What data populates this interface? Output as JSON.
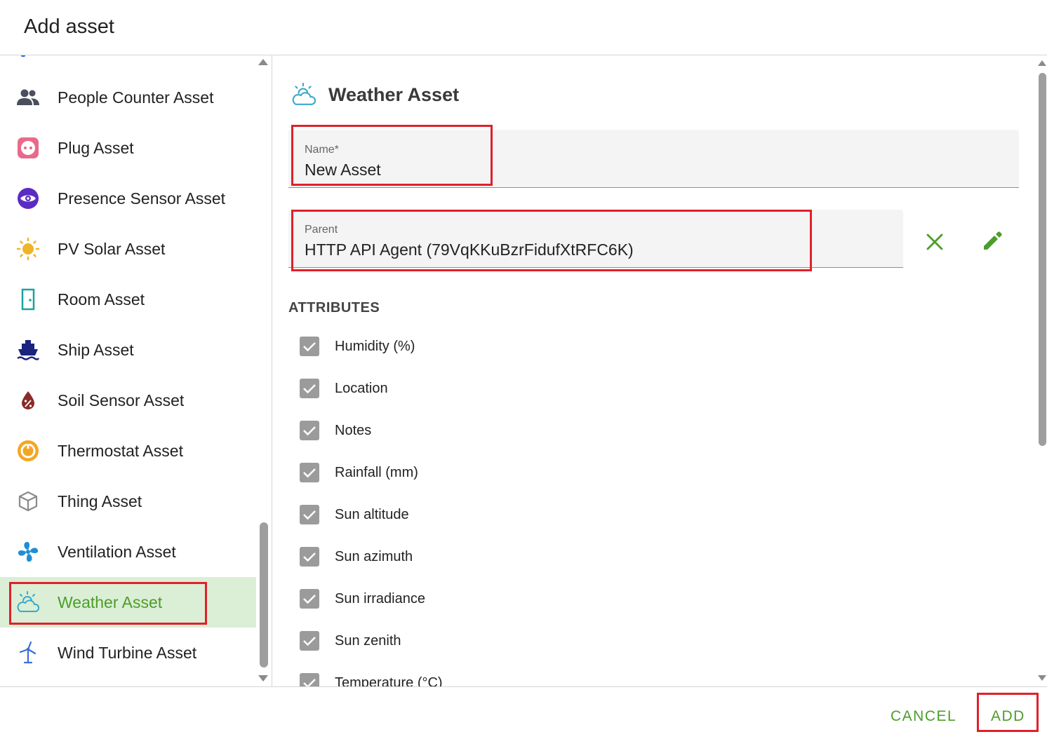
{
  "dialog": {
    "title": "Add asset"
  },
  "asset_list": {
    "items": [
      {
        "label": "People Counter Asset",
        "icon": "people-icon",
        "color": "#4a4f5c"
      },
      {
        "label": "Plug Asset",
        "icon": "plug-icon",
        "color": "#e86a8a"
      },
      {
        "label": "Presence Sensor Asset",
        "icon": "eye-icon",
        "color": "#5b2bc4"
      },
      {
        "label": "PV Solar Asset",
        "icon": "sun-icon",
        "color": "#f0b429"
      },
      {
        "label": "Room Asset",
        "icon": "door-icon",
        "color": "#1aa3a0"
      },
      {
        "label": "Ship Asset",
        "icon": "ship-icon",
        "color": "#1a237e"
      },
      {
        "label": "Soil Sensor Asset",
        "icon": "water-percent-icon",
        "color": "#8b2a2a"
      },
      {
        "label": "Thermostat Asset",
        "icon": "thermostat-icon",
        "color": "#f4a623"
      },
      {
        "label": "Thing Asset",
        "icon": "cube-icon",
        "color": "#8a8a8a"
      },
      {
        "label": "Ventilation Asset",
        "icon": "fan-icon",
        "color": "#1e8fd6"
      },
      {
        "label": "Weather Asset",
        "icon": "weather-icon",
        "color": "#3aa9c9",
        "selected": true
      },
      {
        "label": "Wind Turbine Asset",
        "icon": "wind-turbine-icon",
        "color": "#3a6fd6"
      }
    ]
  },
  "detail": {
    "title": "Weather Asset",
    "name_field": {
      "label": "Name*",
      "value": "New Asset"
    },
    "parent_field": {
      "label": "Parent",
      "value": "HTTP API Agent (79VqKKuBzrFidufXtRFC6K)"
    },
    "attributes_heading": "ATTRIBUTES",
    "attributes": [
      {
        "label": "Humidity (%)",
        "checked": true
      },
      {
        "label": "Location",
        "checked": true
      },
      {
        "label": "Notes",
        "checked": true
      },
      {
        "label": "Rainfall (mm)",
        "checked": true
      },
      {
        "label": "Sun altitude",
        "checked": true
      },
      {
        "label": "Sun azimuth",
        "checked": true
      },
      {
        "label": "Sun irradiance",
        "checked": true
      },
      {
        "label": "Sun zenith",
        "checked": true
      },
      {
        "label": "Temperature (°C)",
        "checked": true
      }
    ]
  },
  "footer": {
    "cancel_label": "CANCEL",
    "add_label": "ADD"
  },
  "colors": {
    "accent": "#4d9d2a",
    "highlight": "#e0202a",
    "selected_bg": "#dbeed6"
  }
}
